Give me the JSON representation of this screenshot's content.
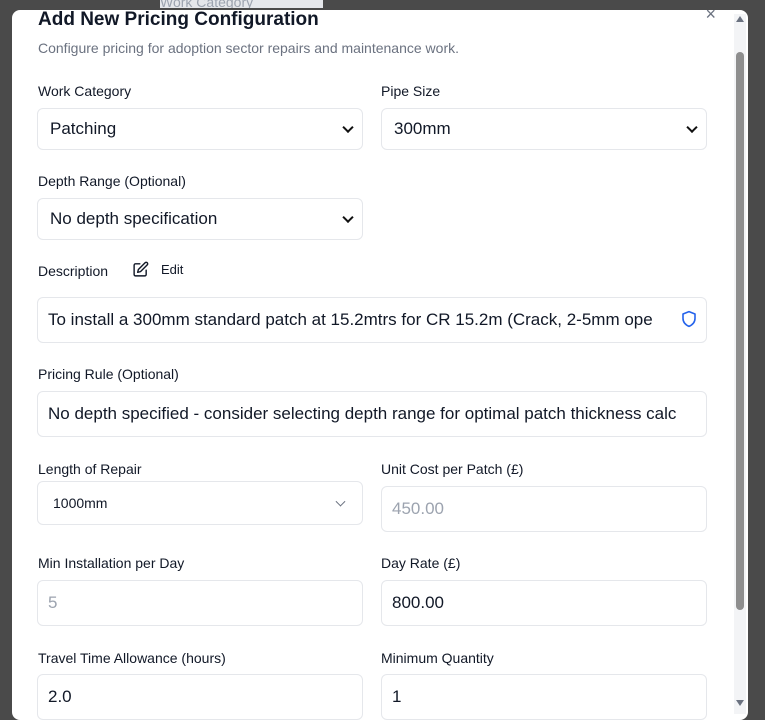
{
  "backdrop": {
    "text": "Work Category"
  },
  "modal": {
    "title": "Add New Pricing Configuration",
    "subtitle": "Configure pricing for adoption sector repairs and maintenance work.",
    "close_label": "×"
  },
  "fields": {
    "work_category": {
      "label": "Work Category",
      "value": "Patching"
    },
    "pipe_size": {
      "label": "Pipe Size",
      "value": "300mm"
    },
    "depth_range": {
      "label": "Depth Range (Optional)",
      "value": "No depth specification"
    },
    "description": {
      "label": "Description",
      "edit_label": "Edit",
      "value": "To install a 300mm standard patch at 15.2mtrs for CR 15.2m (Crack, 2-5mm ope"
    },
    "pricing_rule": {
      "label": "Pricing Rule (Optional)",
      "value": "No depth specified - consider selecting depth range for optimal patch thickness calc"
    },
    "length_of_repair": {
      "label": "Length of Repair",
      "value": "1000mm"
    },
    "unit_cost": {
      "label": "Unit Cost per Patch (£)",
      "placeholder": "450.00"
    },
    "min_installation": {
      "label": "Min Installation per Day",
      "placeholder": "5"
    },
    "day_rate": {
      "label": "Day Rate (£)",
      "value": "800.00"
    },
    "travel_time": {
      "label": "Travel Time Allowance (hours)",
      "value": "2.0"
    },
    "minimum_quantity": {
      "label": "Minimum Quantity",
      "value": "1"
    }
  },
  "icons": {
    "edit": "pencil-square-icon",
    "shield": "shield-icon",
    "accent": "#2563eb"
  }
}
